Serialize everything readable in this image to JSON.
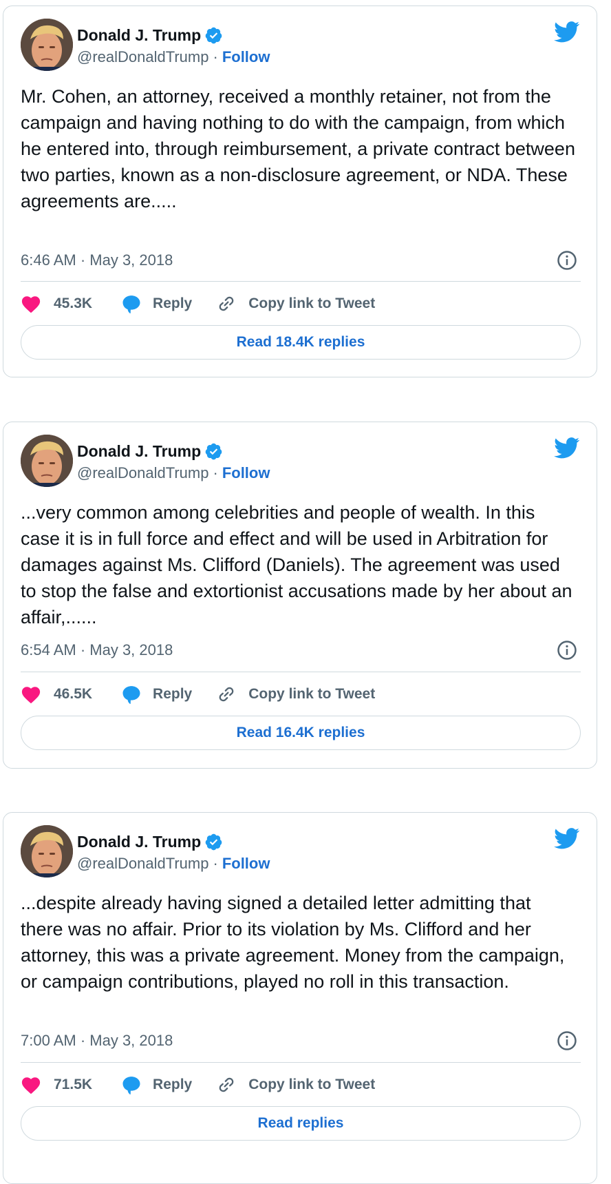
{
  "tweets": [
    {
      "author_name": "Donald J. Trump",
      "handle": "@realDonaldTrump",
      "separator": "·",
      "follow_label": "Follow",
      "text": "Mr. Cohen, an attorney, received a monthly retainer, not from the campaign and having nothing to do with the campaign, from which he entered into, through reimbursement, a private contract between two parties, known as a non-disclosure agreement, or NDA. These agreements are.....",
      "timestamp": "6:46 AM · May 3, 2018",
      "likes": "45.3K",
      "reply_label": "Reply",
      "copy_link_label": "Copy link to Tweet",
      "read_replies_label": "Read 18.4K replies"
    },
    {
      "author_name": "Donald J. Trump",
      "handle": "@realDonaldTrump",
      "separator": "·",
      "follow_label": "Follow",
      "text": "...very common among celebrities and people of wealth. In this case it is in full force and effect and will be used in Arbitration for damages against Ms. Clifford (Daniels). The agreement was used to stop the false and extortionist accusations made by her about an affair,......",
      "timestamp": "6:54 AM · May 3, 2018",
      "likes": "46.5K",
      "reply_label": "Reply",
      "copy_link_label": "Copy link to Tweet",
      "read_replies_label": "Read 16.4K replies"
    },
    {
      "author_name": "Donald J. Trump",
      "handle": "@realDonaldTrump",
      "separator": "·",
      "follow_label": "Follow",
      "text": "...despite already having signed a detailed letter admitting that there was no affair. Prior to its violation by Ms. Clifford and her attorney, this was a private agreement. Money from the campaign, or campaign contributions, played no roll in this transaction.",
      "timestamp": "7:00 AM · May 3, 2018",
      "likes": "71.5K",
      "reply_label": "Reply",
      "copy_link_label": "Copy link to Tweet",
      "read_replies_label": "Read replies"
    }
  ],
  "icons": {
    "brand": "twitter-bird-icon",
    "verified": "verified-badge-icon",
    "info": "info-icon",
    "like": "heart-icon",
    "reply": "speech-bubble-icon",
    "copy": "link-icon"
  },
  "colors": {
    "twitter_blue": "#1d9bf0",
    "link_blue": "#1d6fd1",
    "like_pink": "#f91880",
    "secondary_text": "#536471",
    "border": "#cfd9de"
  }
}
